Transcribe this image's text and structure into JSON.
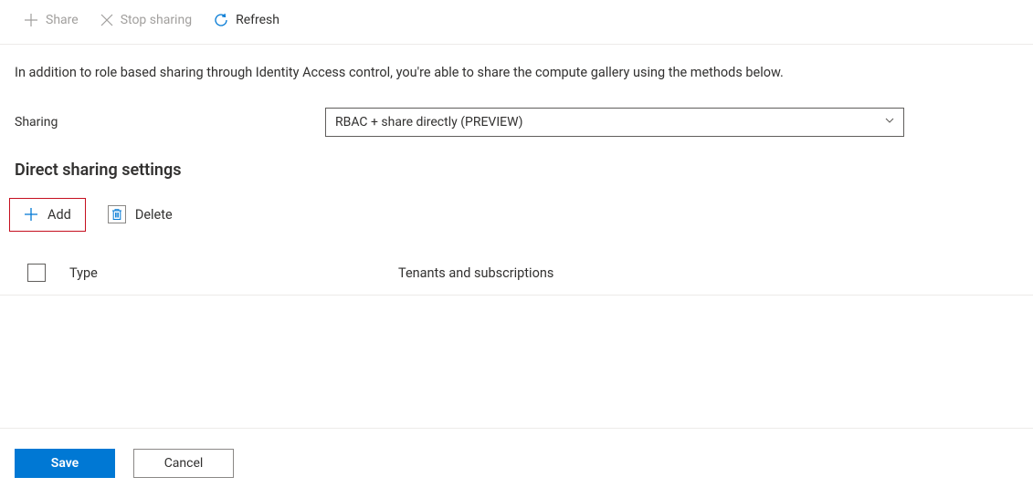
{
  "toolbar": {
    "share": "Share",
    "stop_sharing": "Stop sharing",
    "refresh": "Refresh"
  },
  "description": "In addition to role based sharing through Identity Access control, you're able to share the compute gallery using the methods below.",
  "sharing": {
    "label": "Sharing",
    "selected": "RBAC + share directly (PREVIEW)"
  },
  "section_heading": "Direct sharing settings",
  "actions": {
    "add": "Add",
    "delete": "Delete"
  },
  "table": {
    "type": "Type",
    "tenants": "Tenants and subscriptions"
  },
  "footer": {
    "save": "Save",
    "cancel": "Cancel"
  },
  "colors": {
    "accent": "#0078d4",
    "highlight_border": "#c50f1f"
  }
}
